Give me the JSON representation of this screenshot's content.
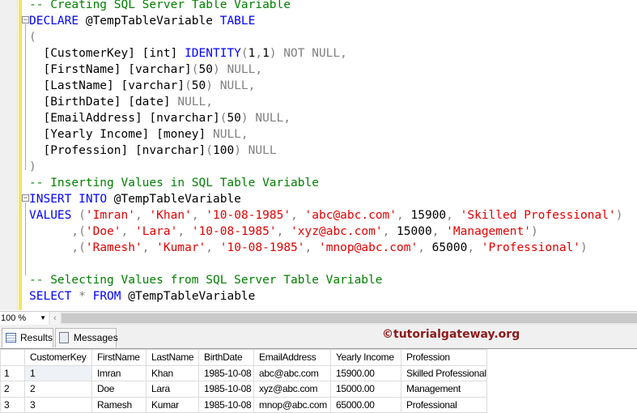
{
  "editor": {
    "lines": [
      [
        [
          "cm",
          "-- Creating SQL Server Table Variable"
        ]
      ],
      [
        [
          "kw",
          "DECLARE"
        ],
        [
          "id",
          " @TempTableVariable "
        ],
        [
          "kw",
          "TABLE"
        ]
      ],
      [
        [
          "gr",
          "("
        ]
      ],
      [
        [
          "id",
          "  [CustomerKey] [int] "
        ],
        [
          "kw",
          "IDENTITY"
        ],
        [
          "gr",
          "("
        ],
        [
          "id",
          "1"
        ],
        [
          "gr",
          ","
        ],
        [
          "id",
          "1"
        ],
        [
          "gr",
          ")"
        ],
        [
          "gr",
          " NOT NULL,"
        ]
      ],
      [
        [
          "id",
          "  [FirstName] [varchar]"
        ],
        [
          "gr",
          "("
        ],
        [
          "id",
          "50"
        ],
        [
          "gr",
          ")"
        ],
        [
          "gr",
          " NULL,"
        ]
      ],
      [
        [
          "id",
          "  [LastName] [varchar]"
        ],
        [
          "gr",
          "("
        ],
        [
          "id",
          "50"
        ],
        [
          "gr",
          ")"
        ],
        [
          "gr",
          " NULL,"
        ]
      ],
      [
        [
          "id",
          "  [BirthDate] [date]"
        ],
        [
          "gr",
          " NULL,"
        ]
      ],
      [
        [
          "id",
          "  [EmailAddress] [nvarchar]"
        ],
        [
          "gr",
          "("
        ],
        [
          "id",
          "50"
        ],
        [
          "gr",
          ")"
        ],
        [
          "gr",
          " NULL,"
        ]
      ],
      [
        [
          "id",
          "  [Yearly Income] [money]"
        ],
        [
          "gr",
          " NULL,"
        ]
      ],
      [
        [
          "id",
          "  [Profession] [nvarchar]"
        ],
        [
          "gr",
          "("
        ],
        [
          "id",
          "100"
        ],
        [
          "gr",
          ")"
        ],
        [
          "gr",
          " NULL"
        ]
      ],
      [
        [
          "gr",
          ")"
        ]
      ],
      [
        [
          "cm",
          "-- Inserting Values in SQL Table Variable"
        ]
      ],
      [
        [
          "kw",
          "INSERT"
        ],
        [
          "id",
          " "
        ],
        [
          "kw",
          "INTO"
        ],
        [
          "id",
          " @TempTableVariable"
        ]
      ],
      [
        [
          "kw",
          "VALUES"
        ],
        [
          "id",
          " "
        ],
        [
          "gr",
          "("
        ],
        [
          "st",
          "'Imran'"
        ],
        [
          "gr",
          ", "
        ],
        [
          "st",
          "'Khan'"
        ],
        [
          "gr",
          ", "
        ],
        [
          "st",
          "'10-08-1985'"
        ],
        [
          "gr",
          ", "
        ],
        [
          "st",
          "'abc@abc.com'"
        ],
        [
          "gr",
          ", "
        ],
        [
          "id",
          "15900"
        ],
        [
          "gr",
          ", "
        ],
        [
          "st",
          "'Skilled Professional'"
        ],
        [
          "gr",
          ")"
        ]
      ],
      [
        [
          "id",
          "      "
        ],
        [
          "gr",
          ",("
        ],
        [
          "st",
          "'Doe'"
        ],
        [
          "gr",
          ", "
        ],
        [
          "st",
          "'Lara'"
        ],
        [
          "gr",
          ", "
        ],
        [
          "st",
          "'10-08-1985'"
        ],
        [
          "gr",
          ", "
        ],
        [
          "st",
          "'xyz@abc.com'"
        ],
        [
          "gr",
          ", "
        ],
        [
          "id",
          "15000"
        ],
        [
          "gr",
          ", "
        ],
        [
          "st",
          "'Management'"
        ],
        [
          "gr",
          ")"
        ]
      ],
      [
        [
          "id",
          "      "
        ],
        [
          "gr",
          ",("
        ],
        [
          "st",
          "'Ramesh'"
        ],
        [
          "gr",
          ", "
        ],
        [
          "st",
          "'Kumar'"
        ],
        [
          "gr",
          ", "
        ],
        [
          "st",
          "'10-08-1985'"
        ],
        [
          "gr",
          ", "
        ],
        [
          "st",
          "'mnop@abc.com'"
        ],
        [
          "gr",
          ", "
        ],
        [
          "id",
          "65000"
        ],
        [
          "gr",
          ", "
        ],
        [
          "st",
          "'Professional'"
        ],
        [
          "gr",
          ")"
        ]
      ],
      [],
      [
        [
          "cm",
          "-- Selecting Values from SQL Server Table Variable"
        ]
      ],
      [
        [
          "kw",
          "SELECT"
        ],
        [
          "id",
          " "
        ],
        [
          "gr",
          "*"
        ],
        [
          "id",
          " "
        ],
        [
          "kw",
          "FROM"
        ],
        [
          "id",
          " @TempTableVariable"
        ]
      ]
    ]
  },
  "zoom": {
    "value": "100 %"
  },
  "tabs": [
    {
      "label": "Results"
    },
    {
      "label": "Messages"
    }
  ],
  "watermark": "©tutorialgateway.org",
  "results": {
    "columns": [
      "CustomerKey",
      "FirstName",
      "LastName",
      "BirthDate",
      "EmailAddress",
      "Yearly Income",
      "Profession"
    ],
    "rows": [
      {
        "num": "1",
        "cells": [
          "1",
          "Imran",
          "Khan",
          "1985-10-08",
          "abc@abc.com",
          "15900.00",
          "Skilled Professional"
        ]
      },
      {
        "num": "2",
        "cells": [
          "2",
          "Doe",
          "Lara",
          "1985-10-08",
          "xyz@abc.com",
          "15000.00",
          "Management"
        ]
      },
      {
        "num": "3",
        "cells": [
          "3",
          "Ramesh",
          "Kumar",
          "1985-10-08",
          "mnop@abc.com",
          "65000.00",
          "Professional"
        ]
      }
    ]
  },
  "colors": {
    "keyword": "#0000ff",
    "comment": "#008000",
    "string": "#e00000",
    "operator": "#808080",
    "watermark": "#8b1a1a"
  }
}
